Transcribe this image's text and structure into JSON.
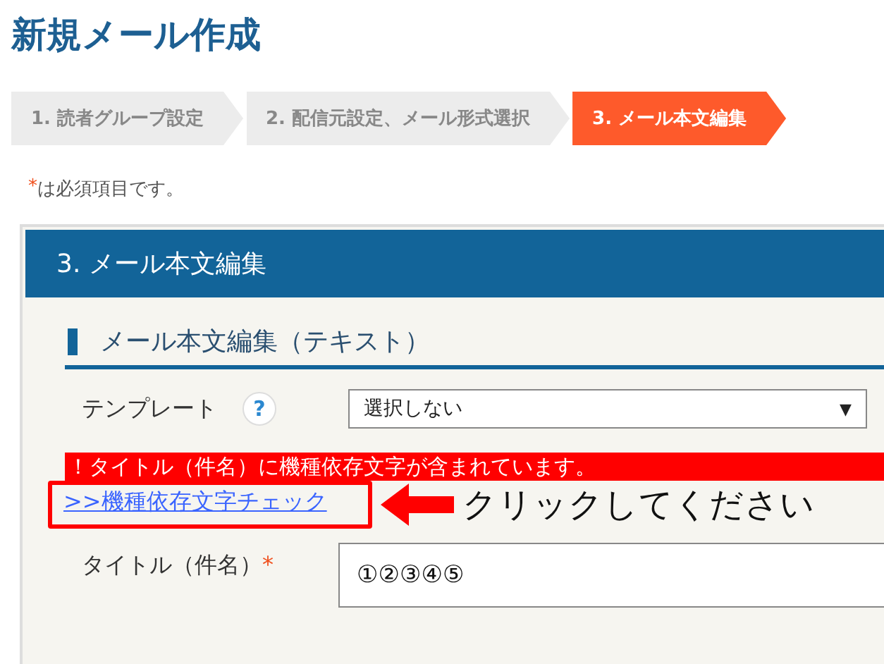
{
  "page_title": "新規メール作成",
  "steps": [
    {
      "label": "1. 読者グループ設定",
      "selected": false
    },
    {
      "label": "2. 配信元設定、メール形式選択",
      "selected": false
    },
    {
      "label": "3. メール本文編集",
      "selected": true
    }
  ],
  "required_note": {
    "mark": "*",
    "text": "は必須項目です。"
  },
  "panel": {
    "title": "3. メール本文編集",
    "section_title": "メール本文編集（テキスト）",
    "template": {
      "label": "テンプレート",
      "help": "?",
      "value": "選択しない",
      "caret": "▼"
    },
    "error": "！タイトル（件名）に機種依存文字が含まれています。",
    "check_link": ">>機種依存文字チェック",
    "callout": "クリックしてください",
    "subject": {
      "label": "タイトル（件名）",
      "required_mark": "*",
      "value": "①②③④⑤"
    }
  }
}
